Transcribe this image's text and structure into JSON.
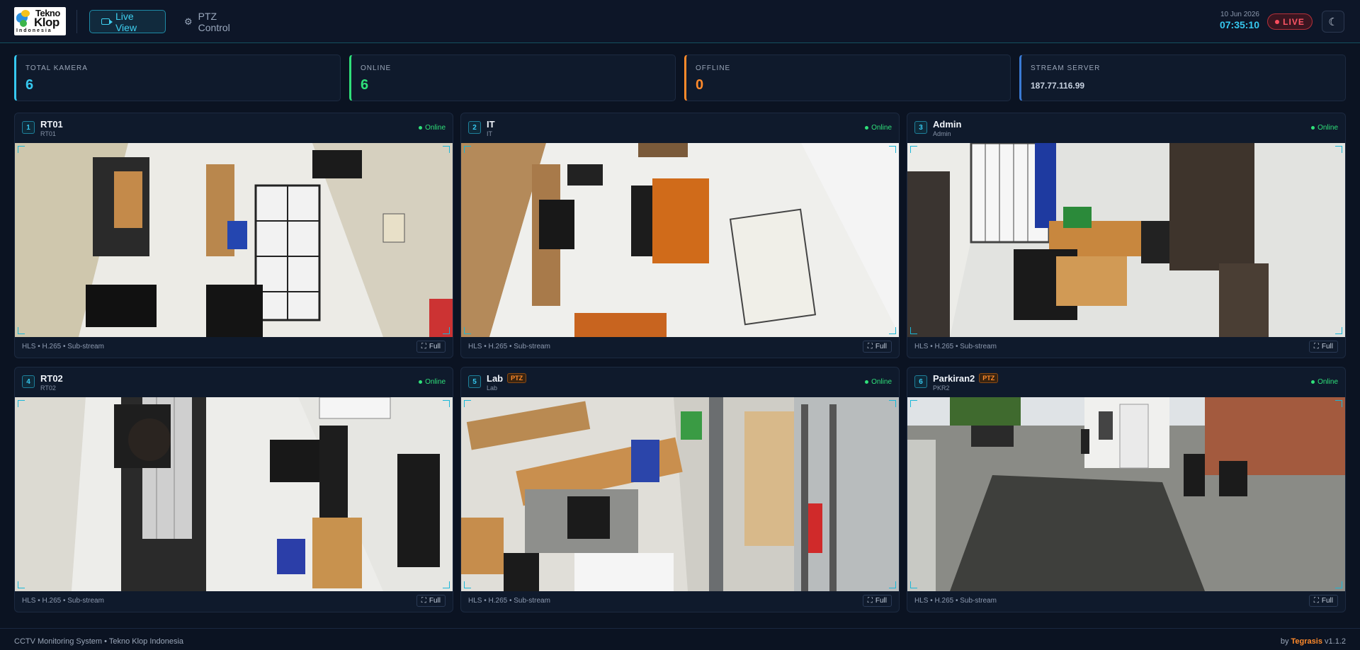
{
  "header": {
    "logo": {
      "line1": "Tekno",
      "line2": "Klop",
      "line3": "Indonesia"
    },
    "nav": [
      {
        "label": "Live View",
        "icon": "camera-icon",
        "active": true
      },
      {
        "label": "PTZ Control",
        "icon": "gear-icon",
        "active": false
      }
    ],
    "date": "10 Jun 2026",
    "time": "07:35:10",
    "live_label": "LIVE",
    "theme_icon": "☾"
  },
  "stats": [
    {
      "label": "TOTAL KAMERA",
      "value": "6",
      "color": "#36c8ef"
    },
    {
      "label": "ONLINE",
      "value": "6",
      "color": "#2fe07a"
    },
    {
      "label": "OFFLINE",
      "value": "0",
      "color": "#ff8a2b"
    },
    {
      "label": "STREAM SERVER",
      "value": "187.77.116.99",
      "color": "#3a7bd5"
    }
  ],
  "cameras": [
    {
      "num": "1",
      "name": "RT01",
      "sub": "RT01",
      "ptz": "",
      "status": "Online",
      "meta": "HLS • H.265 • Sub-stream",
      "full": "Full"
    },
    {
      "num": "2",
      "name": "IT",
      "sub": "IT",
      "ptz": "",
      "status": "Online",
      "meta": "HLS • H.265 • Sub-stream",
      "full": "Full"
    },
    {
      "num": "3",
      "name": "Admin",
      "sub": "Admin",
      "ptz": "",
      "status": "Online",
      "meta": "HLS • H.265 • Sub-stream",
      "full": "Full"
    },
    {
      "num": "4",
      "name": "RT02",
      "sub": "RT02",
      "ptz": "",
      "status": "Online",
      "meta": "HLS • H.265 • Sub-stream",
      "full": "Full"
    },
    {
      "num": "5",
      "name": "Lab",
      "sub": "Lab",
      "ptz": "PTZ",
      "status": "Online",
      "meta": "HLS • H.265 • Sub-stream",
      "full": "Full"
    },
    {
      "num": "6",
      "name": "Parkiran2",
      "sub": "PKR2",
      "ptz": "PTZ",
      "status": "Online",
      "meta": "HLS • H.265 • Sub-stream",
      "full": "Full"
    }
  ],
  "footer": {
    "left": "CCTV Monitoring System • Tekno Klop Indonesia",
    "by": "by ",
    "brand": "Tegrasis",
    "version": " v1.1.2"
  }
}
